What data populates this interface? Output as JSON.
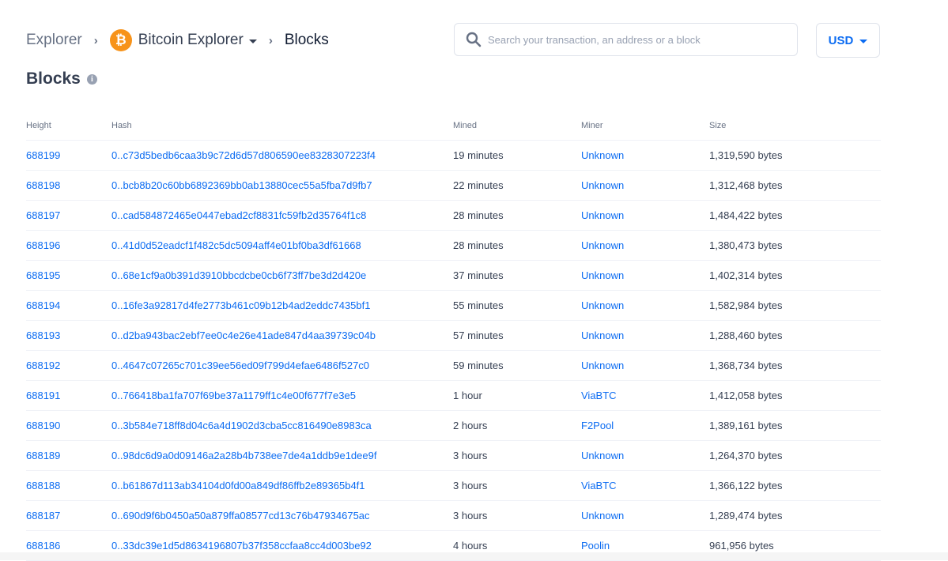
{
  "breadcrumb": {
    "root": "Explorer",
    "explorer": "Bitcoin Explorer",
    "current": "Blocks",
    "coin_symbol": "₿"
  },
  "search": {
    "placeholder": "Search your transaction, an address or a block"
  },
  "currency": "USD",
  "page": {
    "title": "Blocks",
    "info_symbol": "i"
  },
  "table": {
    "headers": {
      "height": "Height",
      "hash": "Hash",
      "mined": "Mined",
      "miner": "Miner",
      "size": "Size"
    },
    "rows": [
      {
        "height": "688199",
        "hash": "0..c73d5bedb6caa3b9c72d6d57d806590ee8328307223f4",
        "mined": "19 minutes",
        "miner": "Unknown",
        "size": "1,319,590 bytes"
      },
      {
        "height": "688198",
        "hash": "0..bcb8b20c60bb6892369bb0ab13880cec55a5fba7d9fb7",
        "mined": "22 minutes",
        "miner": "Unknown",
        "size": "1,312,468 bytes"
      },
      {
        "height": "688197",
        "hash": "0..cad584872465e0447ebad2cf8831fc59fb2d35764f1c8",
        "mined": "28 minutes",
        "miner": "Unknown",
        "size": "1,484,422 bytes"
      },
      {
        "height": "688196",
        "hash": "0..41d0d52eadcf1f482c5dc5094aff4e01bf0ba3df61668",
        "mined": "28 minutes",
        "miner": "Unknown",
        "size": "1,380,473 bytes"
      },
      {
        "height": "688195",
        "hash": "0..68e1cf9a0b391d3910bbcdcbe0cb6f73ff7be3d2d420e",
        "mined": "37 minutes",
        "miner": "Unknown",
        "size": "1,402,314 bytes"
      },
      {
        "height": "688194",
        "hash": "0..16fe3a92817d4fe2773b461c09b12b4ad2eddc7435bf1",
        "mined": "55 minutes",
        "miner": "Unknown",
        "size": "1,582,984 bytes"
      },
      {
        "height": "688193",
        "hash": "0..d2ba943bac2ebf7ee0c4e26e41ade847d4aa39739c04b",
        "mined": "57 minutes",
        "miner": "Unknown",
        "size": "1,288,460 bytes"
      },
      {
        "height": "688192",
        "hash": "0..4647c07265c701c39ee56ed09f799d4efae6486f527c0",
        "mined": "59 minutes",
        "miner": "Unknown",
        "size": "1,368,734 bytes"
      },
      {
        "height": "688191",
        "hash": "0..766418ba1fa707f69be37a1179ff1c4e00f677f7e3e5",
        "mined": "1 hour",
        "miner": "ViaBTC",
        "size": "1,412,058 bytes"
      },
      {
        "height": "688190",
        "hash": "0..3b584e718ff8d04c6a4d1902d3cba5cc816490e8983ca",
        "mined": "2 hours",
        "miner": "F2Pool",
        "size": "1,389,161 bytes"
      },
      {
        "height": "688189",
        "hash": "0..98dc6d9a0d09146a2a28b4b738ee7de4a1ddb9e1dee9f",
        "mined": "3 hours",
        "miner": "Unknown",
        "size": "1,264,370 bytes"
      },
      {
        "height": "688188",
        "hash": "0..b61867d113ab34104d0fd00a849df86ffb2e89365b4f1",
        "mined": "3 hours",
        "miner": "ViaBTC",
        "size": "1,366,122 bytes"
      },
      {
        "height": "688187",
        "hash": "0..690d9f6b0450a50a879ffa08577cd13c76b47934675ac",
        "mined": "3 hours",
        "miner": "Unknown",
        "size": "1,289,474 bytes"
      },
      {
        "height": "688186",
        "hash": "0..33dc39e1d5d8634196807b37f358ccfaa8cc4d003be92",
        "mined": "4 hours",
        "miner": "Poolin",
        "size": "961,956 bytes"
      }
    ]
  },
  "colors": {
    "link": "#0c6cf2",
    "bitcoin": "#f7931a",
    "text": "#353f52",
    "muted": "#677184"
  }
}
